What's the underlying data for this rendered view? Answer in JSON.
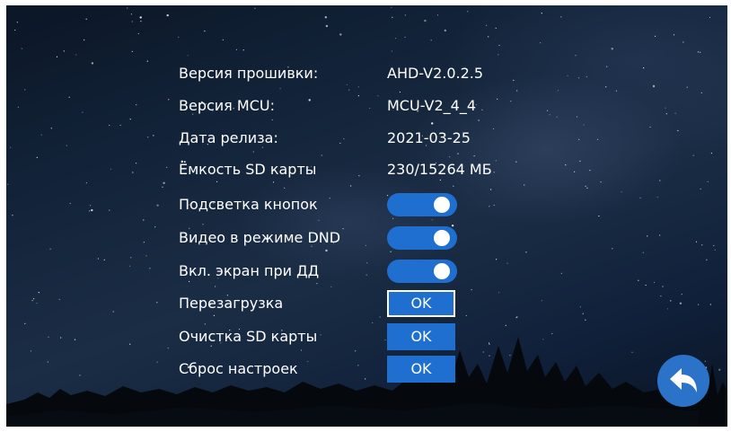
{
  "info": {
    "firmware_label": "Версия прошивки:",
    "firmware_value": "AHD-V2.0.2.5",
    "mcu_label": "Версия MCU:",
    "mcu_value": "MCU-V2_4_4",
    "release_label": "Дата релиза:",
    "release_value": "2021-03-25",
    "sd_capacity_label": "Ёмкость SD карты",
    "sd_capacity_value": "230/15264 МБ"
  },
  "toggles": {
    "button_backlight_label": "Подсветка кнопок",
    "button_backlight_on": true,
    "dnd_video_label": "Видео в режиме DND",
    "dnd_video_on": true,
    "screen_on_dd_label": "Вкл. экран при ДД",
    "screen_on_dd_on": true
  },
  "actions": {
    "reboot_label": "Перезагрузка",
    "reboot_button": "OK",
    "clear_sd_label": "Очистка SD карты",
    "clear_sd_button": "OK",
    "reset_label": "Сброс настроек",
    "reset_button": "OK"
  },
  "colors": {
    "accent": "#1f6fd0",
    "back_button": "#2a73c8",
    "text": "#ffffff"
  },
  "icons": {
    "back": "back-arrow-icon"
  }
}
